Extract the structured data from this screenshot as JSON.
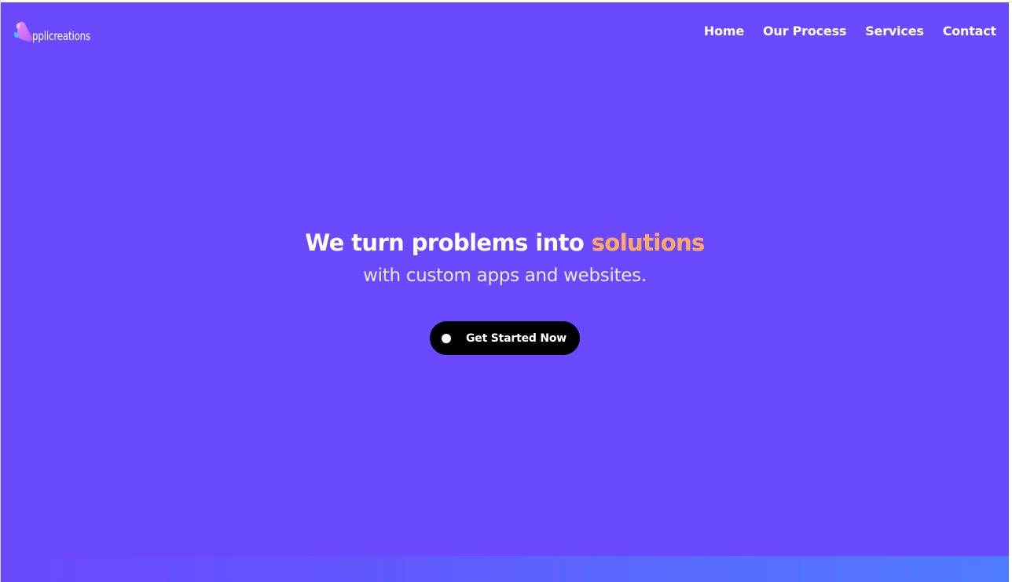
{
  "brand": {
    "logo_text": "pplicreations",
    "logo_icon": "applicreations-logo-icon"
  },
  "nav": {
    "items": [
      "Home",
      "Our Process",
      "Services",
      "Contact"
    ]
  },
  "hero": {
    "headline_main": "We turn problems into ",
    "headline_accent": "solutions",
    "subline": "with custom apps and websites.",
    "cta_label": "Get Started Now"
  },
  "colors": {
    "background": "#6b49ff",
    "accent": "#ffa863",
    "cta_background": "#000000"
  }
}
